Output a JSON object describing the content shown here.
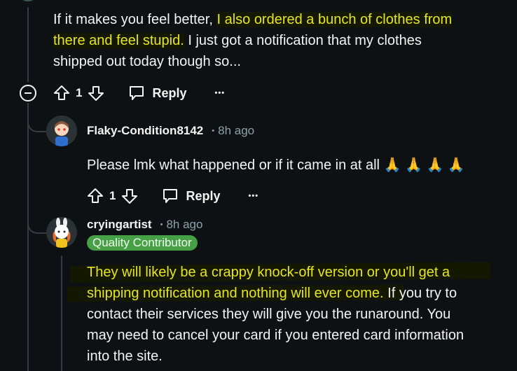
{
  "comments": [
    {
      "body_plain_1": "If it makes you feel better, ",
      "body_highlight_1a": "I also ordered a bunch of clothes from",
      "body_highlight_1b": "there and feel stupid.",
      "body_plain_2": " I just got a notification that my clothes",
      "body_plain_3": "shipped out today though so...",
      "vote_count": "1",
      "reply_label": "Reply",
      "more_label": "•••"
    },
    {
      "username": "Flaky-Condition8142",
      "separator": "•",
      "timestamp": "8h ago",
      "body": "Please lmk what happened or if it came in at all 🙏 🙏 🙏 🙏",
      "vote_count": "1",
      "reply_label": "Reply",
      "more_label": "•••"
    },
    {
      "username": "cryingartist",
      "separator": "•",
      "timestamp": "8h ago",
      "flair": "Quality Contributor",
      "body_highlight_1": "They will likely be a crappy knock-off version or you'll get a",
      "body_highlight_2": "shipping notification and nothing will ever come.",
      "body_plain_2": " If you try to",
      "body_plain_3": "contact their services they will give you the runaround. You",
      "body_plain_4": "may need to cancel your card if you entered card information",
      "body_plain_5": "into the site."
    }
  ],
  "colors": {
    "background": "#0e1113",
    "highlight_text": "#e6e61e",
    "flair_badge": "#46a046",
    "meta_text": "#8ba2ad"
  }
}
